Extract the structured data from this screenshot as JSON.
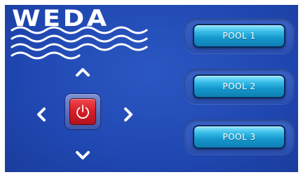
{
  "logo": {
    "text": "WEDA",
    "waves_icon": "waves-icon"
  },
  "dpad": {
    "up_icon": "chevron-up-icon",
    "down_icon": "chevron-down-icon",
    "left_icon": "chevron-left-icon",
    "right_icon": "chevron-right-icon",
    "power_icon": "power-icon",
    "power_color": "#d91f2a"
  },
  "pools": [
    {
      "label": "POOL 1"
    },
    {
      "label": "POOL 2"
    },
    {
      "label": "POOL 3"
    }
  ],
  "colors": {
    "background": "#2048b2",
    "button": "#1597cc"
  }
}
